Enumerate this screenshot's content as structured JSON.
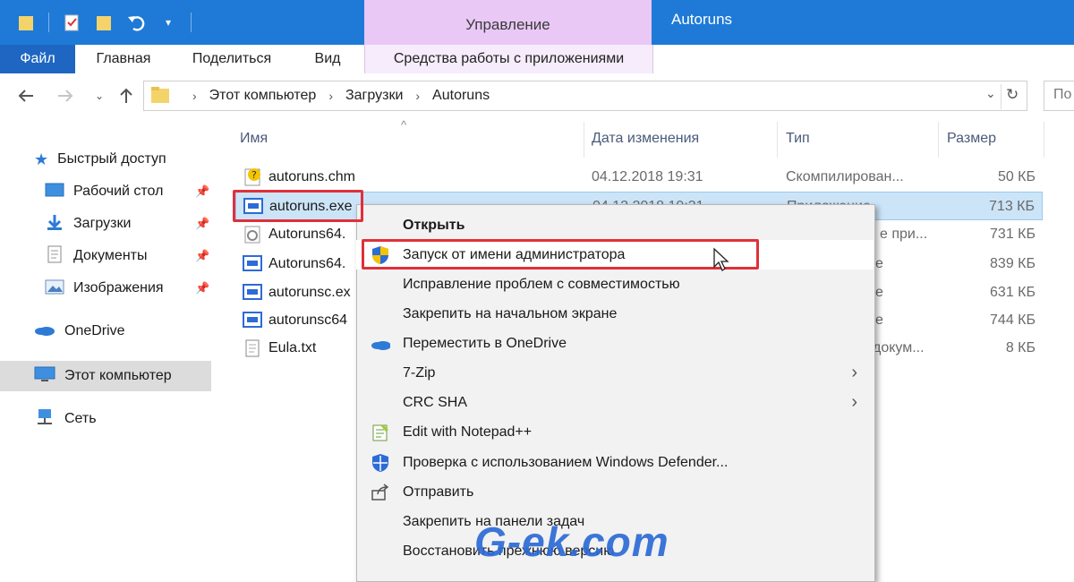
{
  "window": {
    "title": "Autoruns",
    "context_tab": "Управление",
    "context_tools": "Средства работы с приложениями"
  },
  "ribbon": {
    "tabs": [
      "Файл",
      "Главная",
      "Поделиться",
      "Вид"
    ]
  },
  "address": {
    "crumbs": [
      "Этот компьютер",
      "Загрузки",
      "Autoruns"
    ],
    "search_placeholder": "По"
  },
  "nav": {
    "quick_access": "Быстрый доступ",
    "items": [
      {
        "label": "Рабочий стол",
        "icon": "desktop-icon"
      },
      {
        "label": "Загрузки",
        "icon": "downloads-icon"
      },
      {
        "label": "Документы",
        "icon": "documents-icon"
      },
      {
        "label": "Изображения",
        "icon": "pictures-icon"
      }
    ],
    "onedrive": "OneDrive",
    "this_pc": "Этот компьютер",
    "network": "Сеть"
  },
  "columns": {
    "name": "Имя",
    "date": "Дата изменения",
    "type": "Тип",
    "size": "Размер"
  },
  "files": [
    {
      "name": "autoruns.chm",
      "date": "04.12.2018 19:31",
      "type": "Скомпилирован...",
      "size": "50 КБ",
      "icon": "help-file-icon"
    },
    {
      "name": "autoruns.exe",
      "date": "04.12.2018 19:31",
      "type": "Приложение",
      "size": "713 КБ",
      "icon": "exe-icon"
    },
    {
      "name": "Autoruns64.",
      "date": "",
      "type": "е при...",
      "size": "731 КБ",
      "icon": "dll-icon"
    },
    {
      "name": "Autoruns64.",
      "date": "",
      "type": "е",
      "size": "839 КБ",
      "icon": "exe-icon"
    },
    {
      "name": "autorunsc.ex",
      "date": "",
      "type": "е",
      "size": "631 КБ",
      "icon": "exe-icon"
    },
    {
      "name": "autorunsc64",
      "date": "",
      "type": "е",
      "size": "744 КБ",
      "icon": "exe-icon"
    },
    {
      "name": "Eula.txt",
      "date": "",
      "type": "докум...",
      "size": "8 КБ",
      "icon": "text-file-icon"
    }
  ],
  "menu": {
    "items": [
      {
        "label": "Открыть",
        "bold": true
      },
      {
        "label": "Запуск от имени администратора",
        "icon": "shield-icon"
      },
      {
        "label": "Исправление проблем с совместимостью"
      },
      {
        "label": "Закрепить на начальном экране"
      },
      {
        "label": "Переместить в OneDrive",
        "icon": "onedrive-icon"
      },
      {
        "label": "7-Zip",
        "submenu": true
      },
      {
        "label": "CRC SHA",
        "submenu": true
      },
      {
        "label": "Edit with Notepad++",
        "icon": "notepad-icon"
      },
      {
        "label": "Проверка с использованием Windows Defender...",
        "icon": "defender-icon"
      },
      {
        "label": "Отправить",
        "icon": "share-icon"
      },
      {
        "label": "Закрепить на панели задач"
      },
      {
        "label": "Восстановить прежнюю версию"
      }
    ]
  },
  "watermark": "G-ek.com",
  "colors": {
    "titlebar": "#1e7ad6",
    "context_tab": "#e9c8f6",
    "selection": "#cce4f7",
    "highlight": "#e0303a"
  }
}
